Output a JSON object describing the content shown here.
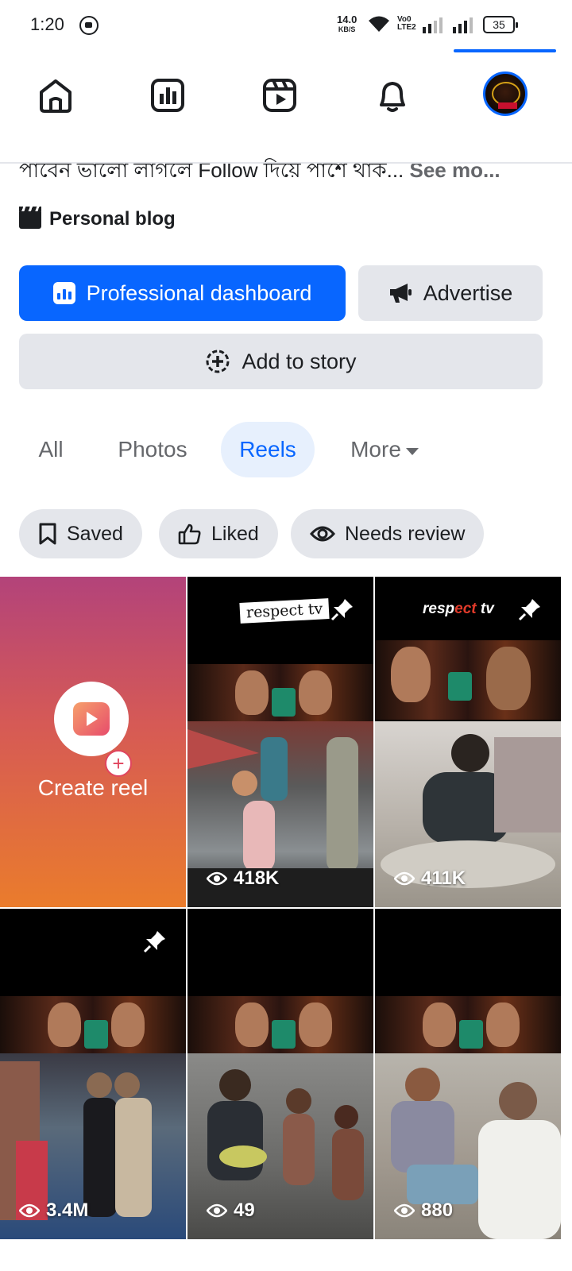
{
  "status_bar": {
    "time": "1:20",
    "net_speed_value": "14.0",
    "net_speed_unit": "KB/S",
    "volte_line1": "Vo0",
    "volte_line2": "LTE2",
    "battery": "35"
  },
  "nav": {
    "items": [
      "home-icon",
      "insights-icon",
      "reels-icon",
      "bell-icon",
      "avatar"
    ],
    "accent": "#0866ff"
  },
  "profile": {
    "bio_text": "পাবেন ভালো লাগলে Follow দিয়ে পাশে থাক...",
    "see_more": "See mo...",
    "category": "Personal blog"
  },
  "actions": {
    "dashboard_label": "Professional dashboard",
    "advertise_label": "Advertise",
    "story_label": "Add to story"
  },
  "tabs": [
    {
      "label": "All",
      "active": false
    },
    {
      "label": "Photos",
      "active": false
    },
    {
      "label": "Reels",
      "active": true
    },
    {
      "label": "More",
      "active": false
    }
  ],
  "filters": [
    {
      "label": "Saved",
      "icon": "bookmark-icon"
    },
    {
      "label": "Liked",
      "icon": "thumbs-up-icon"
    },
    {
      "label": "Needs review",
      "icon": "eye-icon"
    }
  ],
  "reels": {
    "create_label": "Create reel",
    "items": [
      {
        "views": "418K",
        "brand": "respect tv",
        "pinned": true
      },
      {
        "views": "411K",
        "brand": "respect tv",
        "pinned": true
      },
      {
        "views": "3.4M",
        "brand": "",
        "pinned": true
      },
      {
        "views": "49",
        "brand": "",
        "pinned": false
      },
      {
        "views": "880",
        "brand": "",
        "pinned": false
      }
    ]
  }
}
